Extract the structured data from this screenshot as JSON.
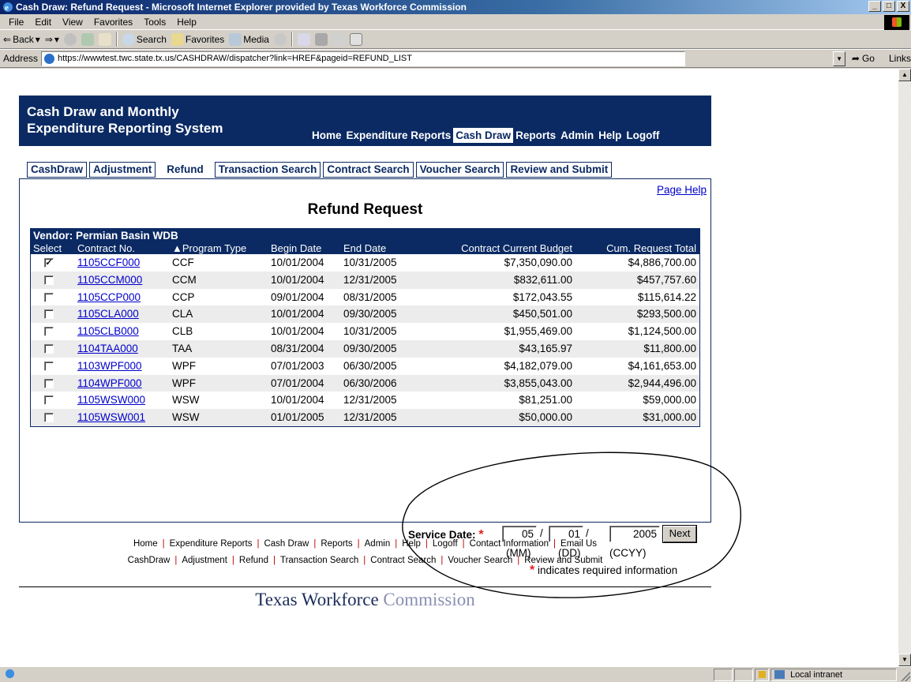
{
  "window": {
    "title": "Cash Draw: Refund Request - Microsoft Internet Explorer provided by Texas Workforce Commission",
    "minimize": "_",
    "restore": "□",
    "close": "X"
  },
  "menu": [
    "File",
    "Edit",
    "View",
    "Favorites",
    "Tools",
    "Help"
  ],
  "toolbar": {
    "back": "Back",
    "search": "Search",
    "favorites": "Favorites",
    "media": "Media"
  },
  "address": {
    "label": "Address",
    "url": "https://wwwtest.twc.state.tx.us/CASHDRAW/dispatcher?link=HREF&pageid=REFUND_LIST",
    "go": "Go",
    "links": "Links"
  },
  "header": {
    "title_line1": "Cash Draw and Monthly",
    "title_line2": "Expenditure Reporting System",
    "nav": [
      "Home",
      "Expenditure Reports",
      "Cash Draw",
      "Reports",
      "Admin",
      "Help",
      "Logoff"
    ],
    "active_nav": "Cash Draw"
  },
  "tabs": [
    "CashDraw",
    "Adjustment",
    "Refund",
    "Transaction Search",
    "Contract Search",
    "Voucher Search",
    "Review and Submit"
  ],
  "active_tab": "Refund",
  "page_help": "Page Help",
  "page_title": "Refund Request",
  "vendor": "Vendor: Permian Basin WDB",
  "columns": {
    "select": "Select",
    "contract": "Contract No.",
    "program": "▲Program Type",
    "begin": "Begin Date",
    "end": "End Date",
    "budget": "Contract Current Budget",
    "cum": "Cum. Request Total"
  },
  "rows": [
    {
      "checked": true,
      "contract": "1105CCF000",
      "program": "CCF",
      "begin": "10/01/2004",
      "end": "10/31/2005",
      "budget": "$7,350,090.00",
      "cum": "$4,886,700.00"
    },
    {
      "checked": false,
      "contract": "1105CCM000",
      "program": "CCM",
      "begin": "10/01/2004",
      "end": "12/31/2005",
      "budget": "$832,611.00",
      "cum": "$457,757.60"
    },
    {
      "checked": false,
      "contract": "1105CCP000",
      "program": "CCP",
      "begin": "09/01/2004",
      "end": "08/31/2005",
      "budget": "$172,043.55",
      "cum": "$115,614.22"
    },
    {
      "checked": false,
      "contract": "1105CLA000",
      "program": "CLA",
      "begin": "10/01/2004",
      "end": "09/30/2005",
      "budget": "$450,501.00",
      "cum": "$293,500.00"
    },
    {
      "checked": false,
      "contract": "1105CLB000",
      "program": "CLB",
      "begin": "10/01/2004",
      "end": "10/31/2005",
      "budget": "$1,955,469.00",
      "cum": "$1,124,500.00"
    },
    {
      "checked": false,
      "contract": "1104TAA000",
      "program": "TAA",
      "begin": "08/31/2004",
      "end": "09/30/2005",
      "budget": "$43,165.97",
      "cum": "$11,800.00"
    },
    {
      "checked": false,
      "contract": "1103WPF000",
      "program": "WPF",
      "begin": "07/01/2003",
      "end": "06/30/2005",
      "budget": "$4,182,079.00",
      "cum": "$4,161,653.00"
    },
    {
      "checked": false,
      "contract": "1104WPF000",
      "program": "WPF",
      "begin": "07/01/2004",
      "end": "06/30/2006",
      "budget": "$3,855,043.00",
      "cum": "$2,944,496.00"
    },
    {
      "checked": false,
      "contract": "1105WSW000",
      "program": "WSW",
      "begin": "10/01/2004",
      "end": "12/31/2005",
      "budget": "$81,251.00",
      "cum": "$59,000.00"
    },
    {
      "checked": false,
      "contract": "1105WSW001",
      "program": "WSW",
      "begin": "01/01/2005",
      "end": "12/31/2005",
      "budget": "$50,000.00",
      "cum": "$31,000.00"
    }
  ],
  "service_date": {
    "label": "Service Date:",
    "required_mark": "*",
    "mm": "05",
    "dd": "01",
    "ccyy": "2005",
    "slash": "/",
    "mm_fmt": "(MM)",
    "dd_fmt": "(DD)",
    "ccyy_fmt": "(CCYY)",
    "next": "Next",
    "required_note": "indicates required information"
  },
  "footer": {
    "row1": [
      "Home",
      "Expenditure Reports",
      "Cash Draw",
      "Reports",
      "Admin",
      "Help",
      "Logoff",
      "Contact Information",
      "Email Us"
    ],
    "row2": [
      "CashDraw",
      "Adjustment",
      "Refund",
      "Transaction Search",
      "Contract Search",
      "Voucher Search",
      "Review and Submit"
    ],
    "sep": "|",
    "brand_dark": "Texas Workforce",
    "brand_light": "Commission"
  },
  "status": {
    "zone": "Local intranet"
  },
  "colors": {
    "navy": "#0b2a63",
    "link": "#0000cc",
    "required": "#e02020",
    "annotation": "#000000"
  }
}
